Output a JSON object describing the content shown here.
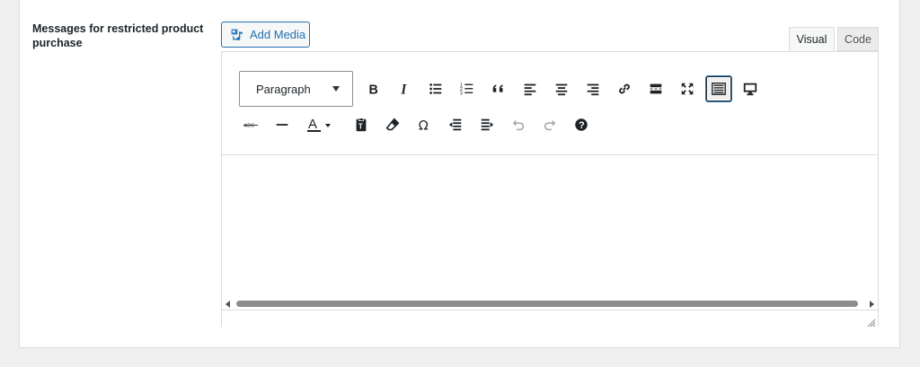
{
  "field": {
    "label": "Messages for restricted product purchase"
  },
  "media": {
    "add_media_label": "Add Media"
  },
  "tabs": {
    "visual": "Visual",
    "code": "Code"
  },
  "toolbar": {
    "format_select": "Paragraph",
    "row1": [
      "bold-icon",
      "italic-icon",
      "bullet-list-icon",
      "numbered-list-icon",
      "blockquote-icon",
      "align-left-icon",
      "align-center-icon",
      "align-right-icon",
      "link-icon",
      "read-more-icon",
      "fullscreen-icon",
      "toolbar-toggle-icon",
      "preview-icon"
    ],
    "row2": [
      "strikethrough-icon",
      "horizontal-line-icon",
      "text-color-icon",
      "paste-text-icon",
      "clear-formatting-icon",
      "special-character-icon",
      "outdent-icon",
      "indent-icon",
      "undo-icon",
      "redo-icon",
      "help-icon"
    ]
  },
  "colors": {
    "accent": "#2271b1",
    "border": "#dcdcde",
    "background": "#f0f0f1"
  }
}
